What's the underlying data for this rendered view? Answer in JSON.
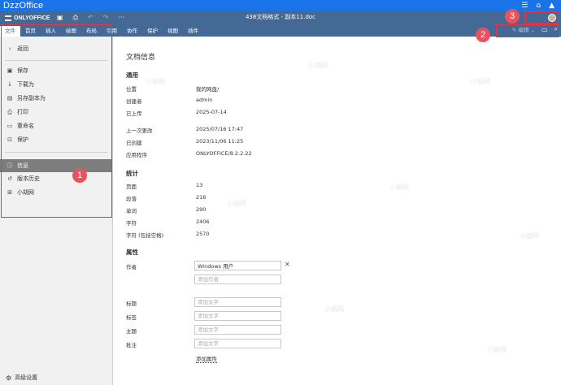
{
  "app": {
    "title": "DzzOffice",
    "top_icons": [
      "menu-icon",
      "home-icon",
      "notification-icon"
    ]
  },
  "editor": {
    "logo": "ONLYOFFICE",
    "doc_title": "438文档格式 - 副本11.doc",
    "tabs": [
      "文件",
      "首页",
      "插入",
      "绘图",
      "布局",
      "引用",
      "协作",
      "保护",
      "视图",
      "插件"
    ],
    "active_tab": "文件",
    "edit_button": "编辑"
  },
  "file_menu": {
    "back": "返回",
    "items": [
      "保存",
      "下载为",
      "另存副本为",
      "打印",
      "重命名",
      "保护"
    ],
    "info": "信息",
    "version_history": "版本历史",
    "xiaohu": "小胡网",
    "advanced_settings": "高级设置"
  },
  "info": {
    "title": "文档信息",
    "general": {
      "heading": "通用",
      "location_label": "位置",
      "location": "我的网盘/",
      "owner_label": "创建者",
      "owner": "admin",
      "uploaded_label": "已上传",
      "uploaded": "2025-07-14",
      "modified_label": "上一次更改",
      "modified": "2025/07/16 17:47",
      "created_label": "已创建",
      "created": "2023/11/06 11:25",
      "app_label": "应用程序",
      "app": "ONLYOFFICE/8.2.2.22"
    },
    "stats": {
      "heading": "统计",
      "pages_label": "页面",
      "pages": "13",
      "paragraphs_label": "段落",
      "paragraphs": "216",
      "words_label": "单词",
      "words": "290",
      "chars_label": "字符",
      "chars": "2406",
      "chars_spaces_label": "字符 (包括空格)",
      "chars_spaces": "2570"
    },
    "props": {
      "heading": "属性",
      "author_label": "作者",
      "author_value": "Windows 用户",
      "add_author_placeholder": "添加作者",
      "title_label": "标题",
      "tags_label": "标签",
      "subject_label": "主题",
      "comment_label": "批注",
      "add_text_placeholder": "添加文字",
      "add_property": "添加属性"
    }
  },
  "annotations": [
    "1",
    "2",
    "3"
  ],
  "watermark_text": "小胡网",
  "colors": {
    "dzz_bar": "#1a73e8",
    "oo_header": "#446995",
    "annotation_red": "#e6364a",
    "selected_item": "#7d7d7d"
  }
}
